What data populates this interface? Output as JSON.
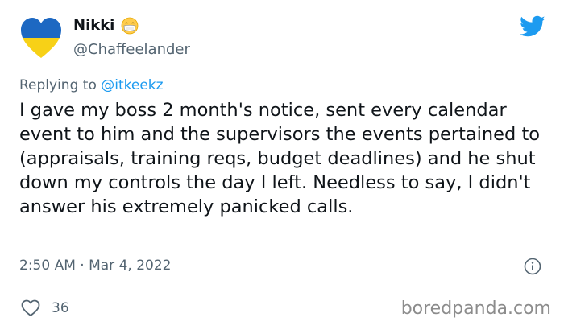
{
  "tweet": {
    "display_name": "Nikki",
    "handle": "@Chaffeelander",
    "emoji_icon": "face-with-medical-mask-icon",
    "replying_prefix": "Replying to ",
    "replying_to": "@itkeekz",
    "text": "I gave my boss 2 month's notice, sent every calendar event to him and the supervisors the events pertained to (appraisals, training reqs, budget deadlines) and he shut down my controls the day I left. Needless to say, I didn't answer his extremely panicked calls.",
    "timestamp": "2:50 AM · Mar 4, 2022",
    "like_count": "36"
  },
  "watermark": "boredpanda.com",
  "colors": {
    "twitter_blue": "#1d9bf0",
    "heart_top_blue": "#1d68c2",
    "heart_bottom_yellow": "#f7d117",
    "secondary_text": "#536471"
  }
}
